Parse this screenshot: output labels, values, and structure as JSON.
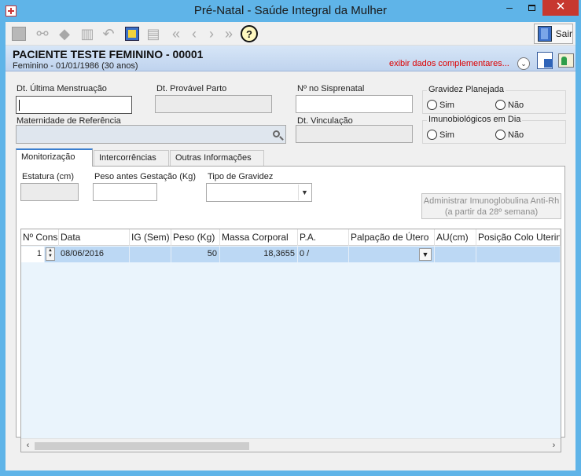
{
  "window": {
    "title": "Pré-Natal - Saúde Integral da Mulher",
    "min": "–",
    "close": "✕"
  },
  "toolbar": {
    "help_label": "?",
    "exit_label": "Sair",
    "icons": [
      "new-icon",
      "binoculars-icon",
      "eraser-icon",
      "trash-icon",
      "undo-icon",
      "notepad-icon",
      "print-icon",
      "first-icon",
      "prev-icon",
      "next-icon",
      "last-icon",
      "help-icon",
      "exit-door-icon"
    ]
  },
  "patient": {
    "name": "PACIENTE TESTE FEMININO - 00001",
    "subtitle": "Feminino - 01/01/1986 (30 anos)",
    "extra_link": "exibir dados complementares...",
    "expand_glyph": "⌄"
  },
  "form": {
    "dum_label": "Dt. Última Menstruação",
    "dum_value": "",
    "dpp_label": "Dt. Provável Parto",
    "dpp_value": "",
    "sisprenatal_label": "Nº no Sisprenatal",
    "sisprenatal_value": "",
    "maternidade_label": "Maternidade de Referência",
    "maternidade_value": "",
    "vinculacao_label": "Dt. Vinculação",
    "vinculacao_value": "",
    "gravidez_planejada": {
      "title": "Gravidez Planejada",
      "yes": "Sim",
      "no": "Não"
    },
    "imunobiologicos": {
      "title": "Imunobiológicos em Dia",
      "yes": "Sim",
      "no": "Não"
    }
  },
  "tabs": [
    {
      "label": "Monitorização",
      "active": true
    },
    {
      "label": "Intercorrências",
      "active": false
    },
    {
      "label": "Outras Informações",
      "active": false
    }
  ],
  "monitor": {
    "estatura_label": "Estatura (cm)",
    "peso_label": "Peso antes Gestação (Kg)",
    "tipo_label": "Tipo de Gravidez",
    "tipo_value": "",
    "rh_button_line1": "Administrar Imunoglobulina Anti-Rh",
    "rh_button_line2": "(a partir da 28º semana)"
  },
  "grid": {
    "columns": [
      "Nº Cons.",
      "Data",
      "IG (Sem)",
      "Peso (Kg)",
      "Massa Corporal",
      "P.A.",
      "Palpação de Útero",
      "AU(cm)",
      "Posição Colo Uterino"
    ],
    "rows": [
      {
        "cons": "1",
        "data": "08/06/2016",
        "ig": "",
        "peso": "50",
        "massa": "18,3655",
        "pa": "0  /",
        "palpacao": "",
        "au": "",
        "posicao": ""
      }
    ],
    "scroll_left": "‹",
    "scroll_right": "›"
  }
}
